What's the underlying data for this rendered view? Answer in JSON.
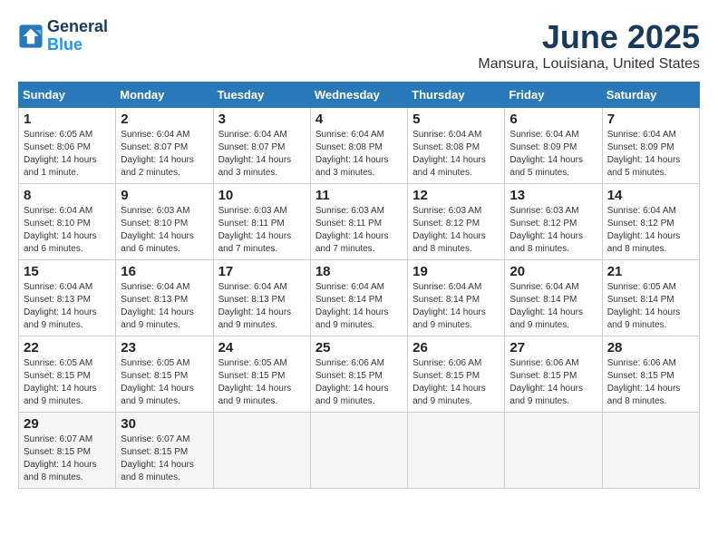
{
  "logo": {
    "line1": "General",
    "line2": "Blue"
  },
  "title": "June 2025",
  "location": "Mansura, Louisiana, United States",
  "headers": [
    "Sunday",
    "Monday",
    "Tuesday",
    "Wednesday",
    "Thursday",
    "Friday",
    "Saturday"
  ],
  "weeks": [
    [
      {
        "day": "1",
        "sunrise": "Sunrise: 6:05 AM",
        "sunset": "Sunset: 8:06 PM",
        "daylight": "Daylight: 14 hours and 1 minute."
      },
      {
        "day": "2",
        "sunrise": "Sunrise: 6:04 AM",
        "sunset": "Sunset: 8:07 PM",
        "daylight": "Daylight: 14 hours and 2 minutes."
      },
      {
        "day": "3",
        "sunrise": "Sunrise: 6:04 AM",
        "sunset": "Sunset: 8:07 PM",
        "daylight": "Daylight: 14 hours and 3 minutes."
      },
      {
        "day": "4",
        "sunrise": "Sunrise: 6:04 AM",
        "sunset": "Sunset: 8:08 PM",
        "daylight": "Daylight: 14 hours and 3 minutes."
      },
      {
        "day": "5",
        "sunrise": "Sunrise: 6:04 AM",
        "sunset": "Sunset: 8:08 PM",
        "daylight": "Daylight: 14 hours and 4 minutes."
      },
      {
        "day": "6",
        "sunrise": "Sunrise: 6:04 AM",
        "sunset": "Sunset: 8:09 PM",
        "daylight": "Daylight: 14 hours and 5 minutes."
      },
      {
        "day": "7",
        "sunrise": "Sunrise: 6:04 AM",
        "sunset": "Sunset: 8:09 PM",
        "daylight": "Daylight: 14 hours and 5 minutes."
      }
    ],
    [
      {
        "day": "8",
        "sunrise": "Sunrise: 6:04 AM",
        "sunset": "Sunset: 8:10 PM",
        "daylight": "Daylight: 14 hours and 6 minutes."
      },
      {
        "day": "9",
        "sunrise": "Sunrise: 6:03 AM",
        "sunset": "Sunset: 8:10 PM",
        "daylight": "Daylight: 14 hours and 6 minutes."
      },
      {
        "day": "10",
        "sunrise": "Sunrise: 6:03 AM",
        "sunset": "Sunset: 8:11 PM",
        "daylight": "Daylight: 14 hours and 7 minutes."
      },
      {
        "day": "11",
        "sunrise": "Sunrise: 6:03 AM",
        "sunset": "Sunset: 8:11 PM",
        "daylight": "Daylight: 14 hours and 7 minutes."
      },
      {
        "day": "12",
        "sunrise": "Sunrise: 6:03 AM",
        "sunset": "Sunset: 8:12 PM",
        "daylight": "Daylight: 14 hours and 8 minutes."
      },
      {
        "day": "13",
        "sunrise": "Sunrise: 6:03 AM",
        "sunset": "Sunset: 8:12 PM",
        "daylight": "Daylight: 14 hours and 8 minutes."
      },
      {
        "day": "14",
        "sunrise": "Sunrise: 6:04 AM",
        "sunset": "Sunset: 8:12 PM",
        "daylight": "Daylight: 14 hours and 8 minutes."
      }
    ],
    [
      {
        "day": "15",
        "sunrise": "Sunrise: 6:04 AM",
        "sunset": "Sunset: 8:13 PM",
        "daylight": "Daylight: 14 hours and 9 minutes."
      },
      {
        "day": "16",
        "sunrise": "Sunrise: 6:04 AM",
        "sunset": "Sunset: 8:13 PM",
        "daylight": "Daylight: 14 hours and 9 minutes."
      },
      {
        "day": "17",
        "sunrise": "Sunrise: 6:04 AM",
        "sunset": "Sunset: 8:13 PM",
        "daylight": "Daylight: 14 hours and 9 minutes."
      },
      {
        "day": "18",
        "sunrise": "Sunrise: 6:04 AM",
        "sunset": "Sunset: 8:14 PM",
        "daylight": "Daylight: 14 hours and 9 minutes."
      },
      {
        "day": "19",
        "sunrise": "Sunrise: 6:04 AM",
        "sunset": "Sunset: 8:14 PM",
        "daylight": "Daylight: 14 hours and 9 minutes."
      },
      {
        "day": "20",
        "sunrise": "Sunrise: 6:04 AM",
        "sunset": "Sunset: 8:14 PM",
        "daylight": "Daylight: 14 hours and 9 minutes."
      },
      {
        "day": "21",
        "sunrise": "Sunrise: 6:05 AM",
        "sunset": "Sunset: 8:14 PM",
        "daylight": "Daylight: 14 hours and 9 minutes."
      }
    ],
    [
      {
        "day": "22",
        "sunrise": "Sunrise: 6:05 AM",
        "sunset": "Sunset: 8:15 PM",
        "daylight": "Daylight: 14 hours and 9 minutes."
      },
      {
        "day": "23",
        "sunrise": "Sunrise: 6:05 AM",
        "sunset": "Sunset: 8:15 PM",
        "daylight": "Daylight: 14 hours and 9 minutes."
      },
      {
        "day": "24",
        "sunrise": "Sunrise: 6:05 AM",
        "sunset": "Sunset: 8:15 PM",
        "daylight": "Daylight: 14 hours and 9 minutes."
      },
      {
        "day": "25",
        "sunrise": "Sunrise: 6:06 AM",
        "sunset": "Sunset: 8:15 PM",
        "daylight": "Daylight: 14 hours and 9 minutes."
      },
      {
        "day": "26",
        "sunrise": "Sunrise: 6:06 AM",
        "sunset": "Sunset: 8:15 PM",
        "daylight": "Daylight: 14 hours and 9 minutes."
      },
      {
        "day": "27",
        "sunrise": "Sunrise: 6:06 AM",
        "sunset": "Sunset: 8:15 PM",
        "daylight": "Daylight: 14 hours and 9 minutes."
      },
      {
        "day": "28",
        "sunrise": "Sunrise: 6:06 AM",
        "sunset": "Sunset: 8:15 PM",
        "daylight": "Daylight: 14 hours and 8 minutes."
      }
    ],
    [
      {
        "day": "29",
        "sunrise": "Sunrise: 6:07 AM",
        "sunset": "Sunset: 8:15 PM",
        "daylight": "Daylight: 14 hours and 8 minutes."
      },
      {
        "day": "30",
        "sunrise": "Sunrise: 6:07 AM",
        "sunset": "Sunset: 8:15 PM",
        "daylight": "Daylight: 14 hours and 8 minutes."
      },
      null,
      null,
      null,
      null,
      null
    ]
  ]
}
